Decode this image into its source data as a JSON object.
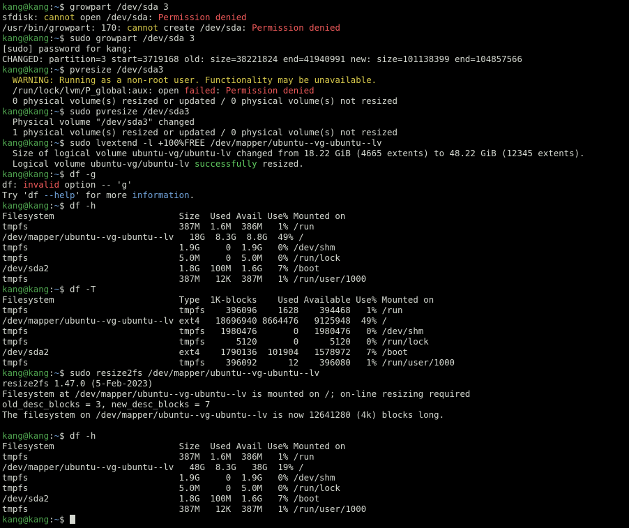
{
  "terminal": {
    "prompt": {
      "user": "kang@kang",
      "path": "~",
      "symbol": "$"
    },
    "lines": [
      {
        "t": "prompt",
        "cmd": "growpart /dev/sda 3"
      },
      {
        "t": "segs",
        "s": [
          [
            "",
            "sfdisk: "
          ],
          [
            "yellow",
            "cannot"
          ],
          [
            "",
            " open /dev/sda: "
          ],
          [
            "red",
            "Permission denied"
          ]
        ]
      },
      {
        "t": "segs",
        "s": [
          [
            "",
            "/usr/bin/growpart: 170: "
          ],
          [
            "yellow",
            "cannot"
          ],
          [
            "",
            " create /dev/sda: "
          ],
          [
            "red",
            "Permission denied"
          ]
        ]
      },
      {
        "t": "prompt",
        "cmd": "sudo growpart /dev/sda 3"
      },
      {
        "t": "text",
        "v": "[sudo] password for kang:"
      },
      {
        "t": "text",
        "v": "CHANGED: partition=3 start=3719168 old: size=38221824 end=41940991 new: size=101138399 end=104857566"
      },
      {
        "t": "prompt",
        "cmd": "pvresize /dev/sda3"
      },
      {
        "t": "segs",
        "s": [
          [
            "",
            "  "
          ],
          [
            "yellow",
            "WARNING"
          ],
          [
            "yellow",
            ": Running as a non-root user. Functionality may be unavailable."
          ]
        ]
      },
      {
        "t": "segs",
        "s": [
          [
            "",
            "  /run/lock/lvm/P_global:aux: open "
          ],
          [
            "red",
            "failed"
          ],
          [
            "",
            ": "
          ],
          [
            "red",
            "Permission denied"
          ]
        ]
      },
      {
        "t": "text",
        "v": "  0 physical volume(s) resized or updated / 0 physical volume(s) not resized"
      },
      {
        "t": "prompt",
        "cmd": "sudo pvresize /dev/sda3"
      },
      {
        "t": "text",
        "v": "  Physical volume \"/dev/sda3\" changed"
      },
      {
        "t": "text",
        "v": "  1 physical volume(s) resized or updated / 0 physical volume(s) not resized"
      },
      {
        "t": "prompt",
        "cmd": "sudo lvextend -l +100%FREE /dev/mapper/ubuntu--vg-ubuntu--lv"
      },
      {
        "t": "text",
        "v": "  Size of logical volume ubuntu-vg/ubuntu-lv changed from 18.22 GiB (4665 extents) to 48.22 GiB (12345 extents)."
      },
      {
        "t": "segs",
        "s": [
          [
            "",
            "  Logical volume ubuntu-vg/ubuntu-lv "
          ],
          [
            "green",
            "successfully"
          ],
          [
            "",
            " resized."
          ]
        ]
      },
      {
        "t": "prompt",
        "cmd": "df -g"
      },
      {
        "t": "segs",
        "s": [
          [
            "",
            "df: "
          ],
          [
            "red",
            "invalid"
          ],
          [
            "",
            " option -- 'g'"
          ]
        ]
      },
      {
        "t": "segs",
        "s": [
          [
            "",
            "Try 'df "
          ],
          [
            "blue",
            "--help"
          ],
          [
            "",
            "' for more "
          ],
          [
            "blue",
            "information"
          ],
          [
            "",
            "."
          ]
        ]
      },
      {
        "t": "prompt",
        "cmd": "df -h"
      },
      {
        "t": "text",
        "v": "Filesystem                        Size  Used Avail Use% Mounted on"
      },
      {
        "t": "text",
        "v": "tmpfs                             387M  1.6M  386M   1% /run"
      },
      {
        "t": "text",
        "v": "/dev/mapper/ubuntu--vg-ubuntu--lv   18G  8.3G  8.8G  49% /"
      },
      {
        "t": "text",
        "v": "tmpfs                             1.9G     0  1.9G   0% /dev/shm"
      },
      {
        "t": "text",
        "v": "tmpfs                             5.0M     0  5.0M   0% /run/lock"
      },
      {
        "t": "text",
        "v": "/dev/sda2                         1.8G  100M  1.6G   7% /boot"
      },
      {
        "t": "text",
        "v": "tmpfs                             387M   12K  387M   1% /run/user/1000"
      },
      {
        "t": "prompt",
        "cmd": "df -T"
      },
      {
        "t": "text",
        "v": "Filesystem                        Type  1K-blocks    Used Available Use% Mounted on"
      },
      {
        "t": "text",
        "v": "tmpfs                             tmpfs    396096    1628    394468   1% /run"
      },
      {
        "t": "text",
        "v": "/dev/mapper/ubuntu--vg-ubuntu--lv ext4   18696940 8664476   9125948  49% /"
      },
      {
        "t": "text",
        "v": "tmpfs                             tmpfs   1980476       0   1980476   0% /dev/shm"
      },
      {
        "t": "text",
        "v": "tmpfs                             tmpfs      5120       0      5120   0% /run/lock"
      },
      {
        "t": "text",
        "v": "/dev/sda2                         ext4    1790136  101904   1578972   7% /boot"
      },
      {
        "t": "text",
        "v": "tmpfs                             tmpfs    396092      12    396080   1% /run/user/1000"
      },
      {
        "t": "prompt",
        "cmd": "sudo resize2fs /dev/mapper/ubuntu--vg-ubuntu--lv"
      },
      {
        "t": "text",
        "v": "resize2fs 1.47.0 (5-Feb-2023)"
      },
      {
        "t": "text",
        "v": "Filesystem at /dev/mapper/ubuntu--vg-ubuntu--lv is mounted on /; on-line resizing required"
      },
      {
        "t": "text",
        "v": "old_desc_blocks = 3, new_desc_blocks = 7"
      },
      {
        "t": "text",
        "v": "The filesystem on /dev/mapper/ubuntu--vg-ubuntu--lv is now 12641280 (4k) blocks long."
      },
      {
        "t": "text",
        "v": ""
      },
      {
        "t": "prompt",
        "cmd": "df -h"
      },
      {
        "t": "text",
        "v": "Filesystem                        Size  Used Avail Use% Mounted on"
      },
      {
        "t": "text",
        "v": "tmpfs                             387M  1.6M  386M   1% /run"
      },
      {
        "t": "text",
        "v": "/dev/mapper/ubuntu--vg-ubuntu--lv   48G  8.3G   38G  19% /"
      },
      {
        "t": "text",
        "v": "tmpfs                             1.9G     0  1.9G   0% /dev/shm"
      },
      {
        "t": "text",
        "v": "tmpfs                             5.0M     0  5.0M   0% /run/lock"
      },
      {
        "t": "text",
        "v": "/dev/sda2                         1.8G  100M  1.6G   7% /boot"
      },
      {
        "t": "text",
        "v": "tmpfs                             387M   12K  387M   1% /run/user/1000"
      },
      {
        "t": "prompt",
        "cmd": "",
        "cursor": true
      }
    ]
  }
}
